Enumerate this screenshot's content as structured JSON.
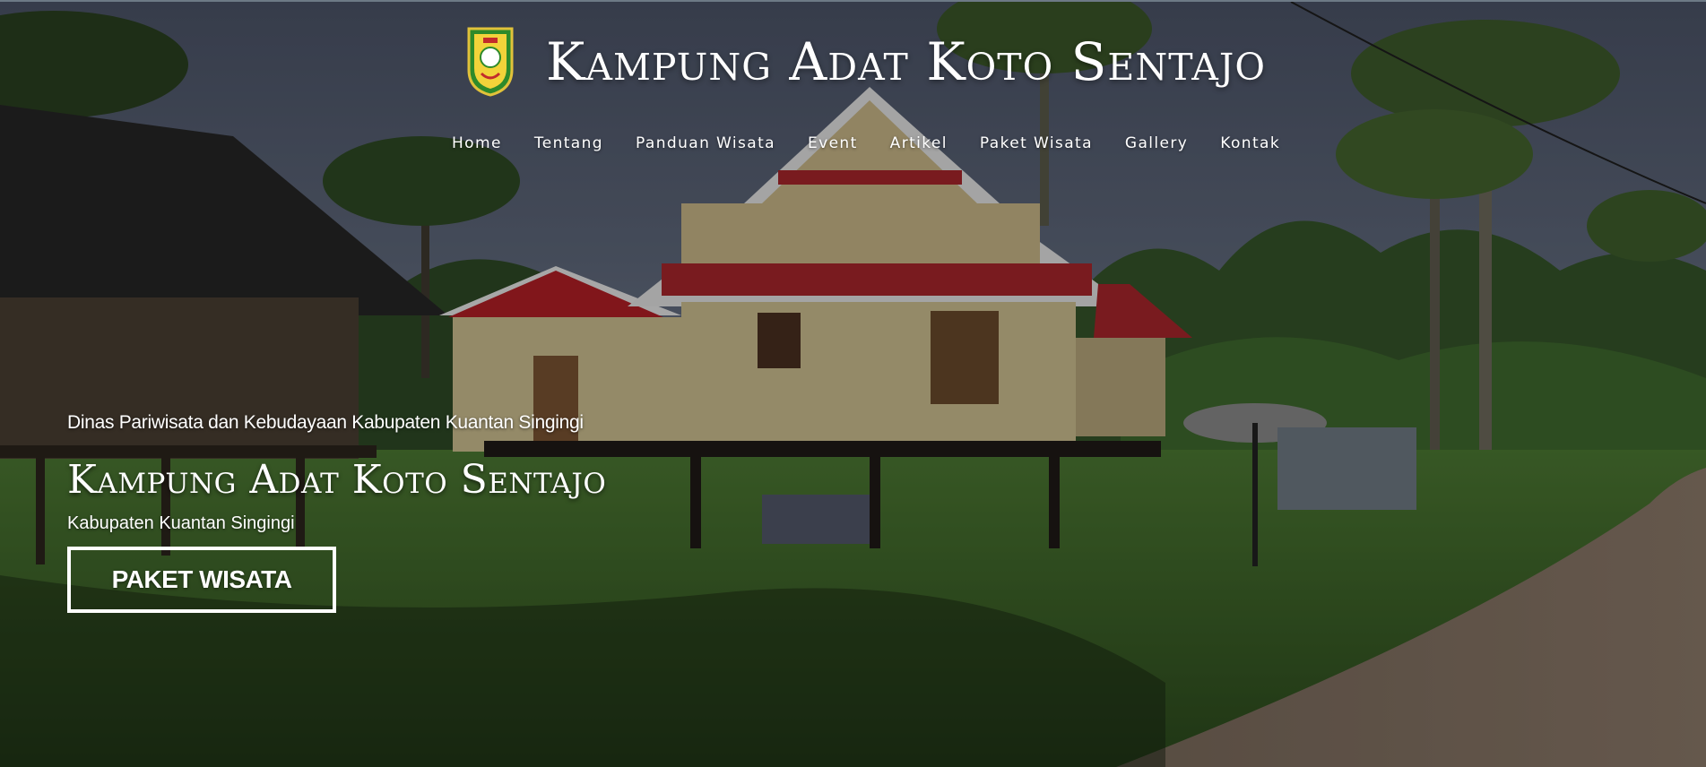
{
  "header": {
    "site_title": "Kampung Adat Koto Sentajo",
    "logo_icon": "regency-crest-icon"
  },
  "nav": {
    "items": [
      {
        "label": "Home"
      },
      {
        "label": "Tentang"
      },
      {
        "label": "Panduan Wisata"
      },
      {
        "label": "Event"
      },
      {
        "label": "Artikel"
      },
      {
        "label": "Paket Wisata"
      },
      {
        "label": "Gallery"
      },
      {
        "label": "Kontak"
      }
    ]
  },
  "hero": {
    "kicker": "Dinas Pariwisata dan Kebudayaan Kabupaten Kuantan Singingi",
    "title": "Kampung Adat Koto Sentajo",
    "subtitle": "Kabupaten Kuantan Singingi",
    "cta_label": "PAKET WISATA",
    "background_icon": "traditional-house-photo"
  },
  "colors": {
    "text": "#ffffff",
    "roof_red": "#a8262b",
    "wall_yellow": "#c9b98a",
    "grass": "#3f6a2a",
    "sky": "#586176"
  }
}
